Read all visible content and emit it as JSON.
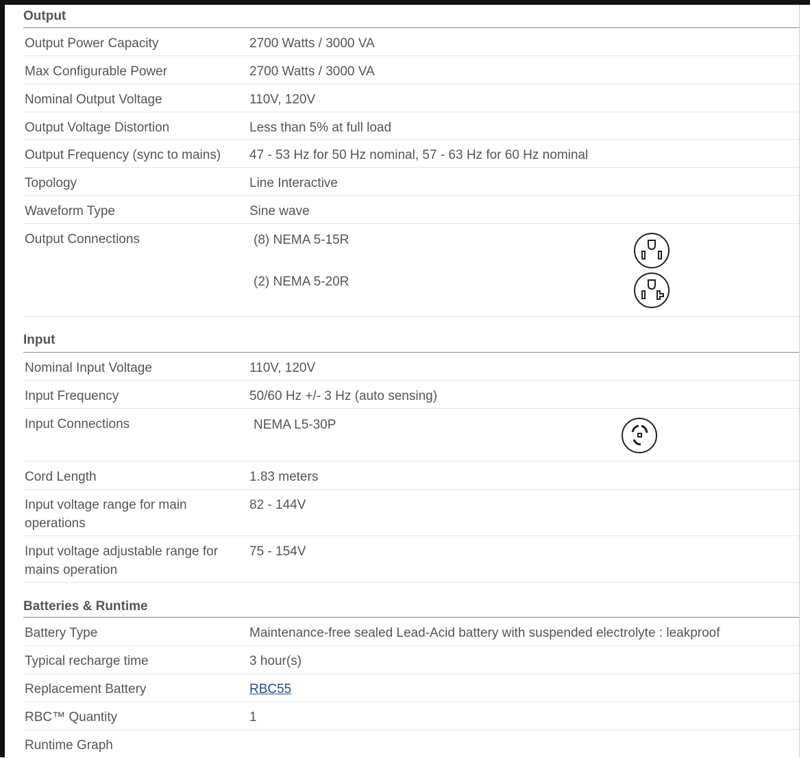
{
  "sections": {
    "output": {
      "title": "Output",
      "rows": [
        {
          "label": "Output Power Capacity",
          "value": "2700 Watts / 3000 VA"
        },
        {
          "label": "Max Configurable Power",
          "value": "2700 Watts / 3000 VA"
        },
        {
          "label": "Nominal Output Voltage",
          "value": "110V, 120V"
        },
        {
          "label": "Output Voltage Distortion",
          "value": "Less than 5% at full load"
        },
        {
          "label": "Output Frequency (sync to mains)",
          "value": "47 - 53 Hz for 50 Hz nominal, 57 - 63 Hz for 60 Hz nominal"
        },
        {
          "label": "Topology",
          "value": "Line Interactive"
        },
        {
          "label": "Waveform Type",
          "value": "Sine wave"
        }
      ],
      "connections": {
        "label": "Output Connections",
        "items": [
          {
            "text": "(8) NEMA 5-15R",
            "icon": "nema-5-15r-outlet-icon"
          },
          {
            "text": "(2) NEMA 5-20R",
            "icon": "nema-5-20r-outlet-icon"
          }
        ]
      }
    },
    "input": {
      "title": "Input",
      "rows": [
        {
          "label": "Nominal Input Voltage",
          "value": "110V, 120V"
        },
        {
          "label": "Input Frequency",
          "value": "50/60 Hz +/- 3 Hz (auto sensing)"
        }
      ],
      "connections": {
        "label": "Input Connections",
        "items": [
          {
            "text": "NEMA L5-30P",
            "icon": "nema-l5-30p-plug-icon"
          }
        ]
      },
      "rows2": [
        {
          "label": "Cord Length",
          "value": "1.83 meters"
        },
        {
          "label": "Input voltage range for main operations",
          "value": "82 - 144V"
        },
        {
          "label": "Input voltage adjustable range for mains operation",
          "value": "75 - 154V"
        }
      ]
    },
    "batteries": {
      "title": "Batteries & Runtime",
      "rows": [
        {
          "label": "Battery Type",
          "value": "Maintenance-free sealed Lead-Acid battery with suspended electrolyte : leakproof"
        },
        {
          "label": "Typical recharge time",
          "value": "3 hour(s)"
        },
        {
          "label": "Replacement Battery",
          "value": "RBC55"
        },
        {
          "label": "RBC™ Quantity",
          "value": "1"
        },
        {
          "label": "Runtime Graph",
          "value": ""
        }
      ]
    }
  },
  "colors": {
    "text": "#555555",
    "link": "#1f4f8f",
    "rule": "#e6e6e6",
    "head_rule": "#8a8a8a"
  }
}
